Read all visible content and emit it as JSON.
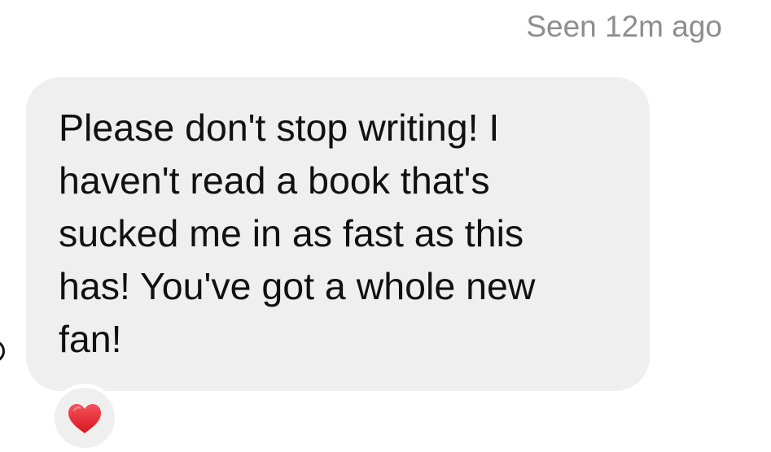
{
  "thread": {
    "seen_status": "Seen 12m ago"
  },
  "message": {
    "text": "Please don't stop writing! I\nhaven't read a book that's\nsucked me in as fast as this\nhas! You've got a whole new\nfan!",
    "reaction": {
      "icon": "heart-icon",
      "color": "#e8202e"
    }
  },
  "colors": {
    "bubble_background": "#efefef",
    "muted_text": "#8e8e8e",
    "message_text": "#111111"
  }
}
